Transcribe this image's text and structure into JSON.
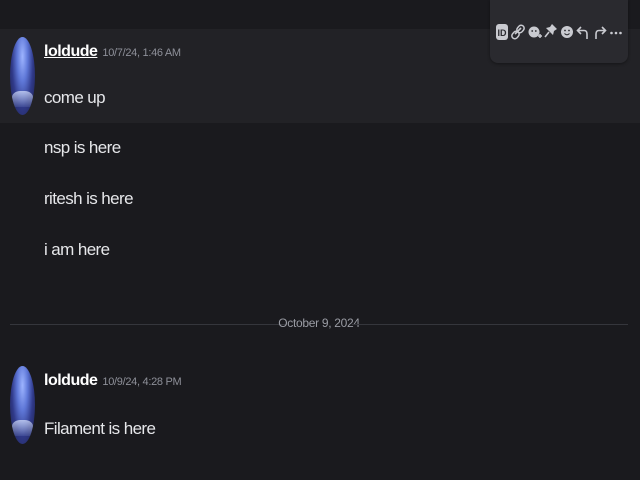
{
  "toolbar": {
    "icons": [
      "id-icon",
      "link-icon",
      "add-reaction-icon",
      "pin-icon",
      "emoji-icon",
      "reply-icon",
      "forward-icon",
      "more-icon"
    ]
  },
  "messages": [
    {
      "author": "loldude",
      "timestamp": "10/7/24, 1:46 AM",
      "lines": [
        "come up",
        "nsp is here",
        "ritesh is here",
        "i am here"
      ]
    },
    {
      "author": "loldude",
      "timestamp": "10/9/24, 4:28 PM",
      "lines": [
        "Filament is here"
      ]
    }
  ],
  "divider": {
    "date": "October 9, 2024"
  },
  "colors": {
    "background": "#1a1a1e",
    "hover": "#222226",
    "toolbar": "#2a2a2f"
  }
}
